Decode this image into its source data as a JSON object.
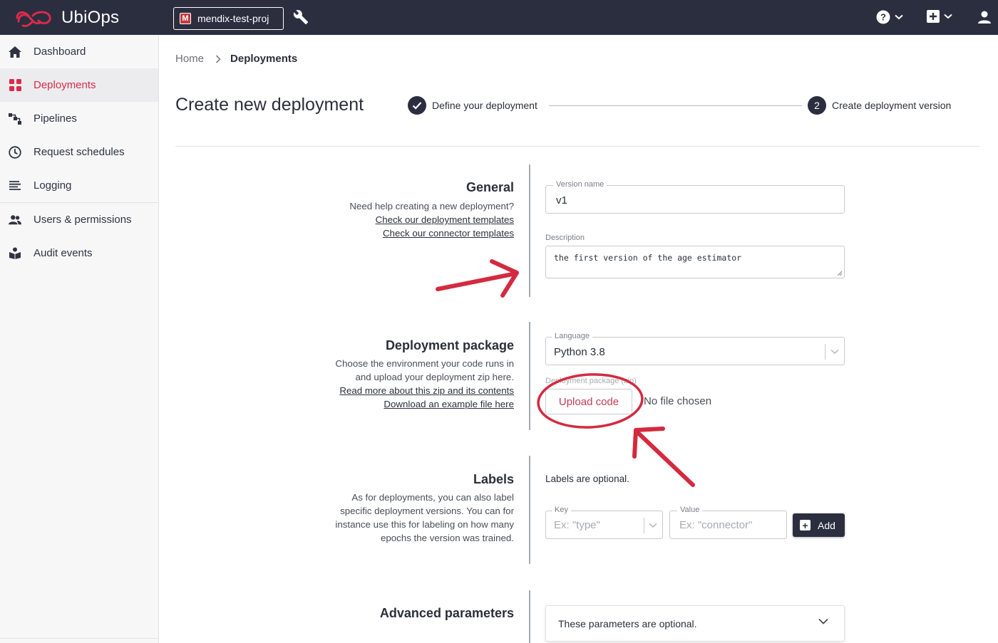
{
  "app": {
    "name": "UbiOps",
    "project_badge": "M",
    "project_name": "mendix-test-proj"
  },
  "sidebar": {
    "items": [
      {
        "label": "Dashboard",
        "icon": "home-icon"
      },
      {
        "label": "Deployments",
        "icon": "deployments-icon",
        "active": true
      },
      {
        "label": "Pipelines",
        "icon": "pipelines-icon"
      },
      {
        "label": "Request schedules",
        "icon": "clock-icon"
      },
      {
        "label": "Logging",
        "icon": "list-icon"
      },
      {
        "label": "Users & permissions",
        "icon": "users-icon"
      },
      {
        "label": "Audit events",
        "icon": "audit-icon"
      }
    ]
  },
  "breadcrumb": {
    "home": "Home",
    "current": "Deployments"
  },
  "page": {
    "title": "Create new deployment",
    "step1": "Define your deployment",
    "step2_number": "2",
    "step2": "Create deployment version"
  },
  "general": {
    "title": "General",
    "help": "Need help creating a new deployment?",
    "link1": "Check our deployment templates",
    "link2": "Check our connector templates",
    "version_label": "Version name",
    "version_value": "v1",
    "description_label": "Description",
    "description_value": "the first version of the age estimator"
  },
  "package": {
    "title": "Deployment package",
    "desc1": "Choose the environment your code runs in",
    "desc2": "and upload your deployment zip here.",
    "link1": "Read more about this zip and its contents",
    "link2": "Download an example file here",
    "language_label": "Language",
    "language_value": "Python 3.8",
    "package_label": "Deployment package (zip)",
    "upload_label": "Upload code",
    "no_file": "No file chosen"
  },
  "labels": {
    "title": "Labels",
    "desc1": "As for deployments, you can also label",
    "desc2": "specific deployment versions. You can for",
    "desc3": "instance use this for labeling on how many",
    "desc4": "epochs the version was trained.",
    "optional": "Labels are optional.",
    "key_label": "Key",
    "key_placeholder": "Ex: \"type\"",
    "value_label": "Value",
    "value_placeholder": "Ex: \"connector\"",
    "add_label": "Add"
  },
  "advanced": {
    "title": "Advanced parameters",
    "optional": "These parameters are optional."
  },
  "colors": {
    "topbar": "#2a2e3f",
    "accent": "#d92b4a",
    "annotation": "#d42a3f"
  }
}
